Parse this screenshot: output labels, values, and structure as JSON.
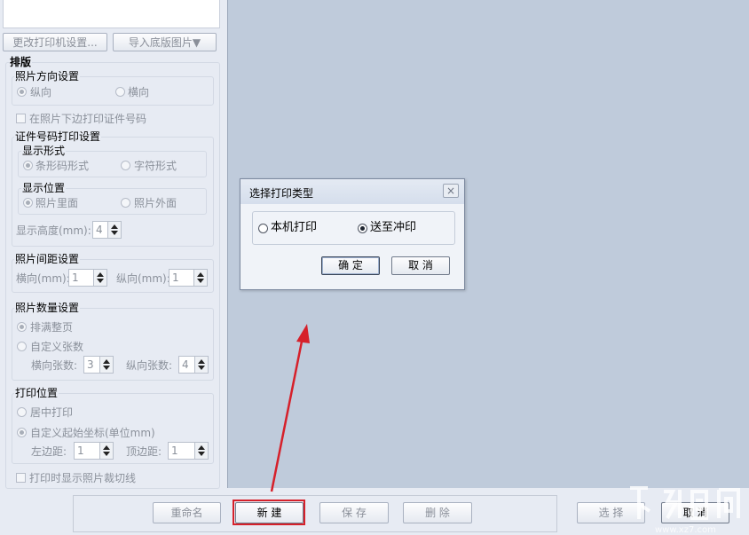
{
  "left_panel": {
    "change_printer_button": "更改打印机设置...",
    "import_background_button": "导入底版图片▼",
    "layout_section": {
      "title": "排版",
      "orientation": {
        "title": "照片方向设置",
        "portrait": "纵向",
        "landscape": "横向",
        "selected": "纵向"
      },
      "print_id_checkbox": "在照片下边打印证件号码",
      "id_print_settings": {
        "title": "证件号码打印设置",
        "display_form": {
          "title": "显示形式",
          "barcode": "条形码形式",
          "text": "字符形式",
          "selected": "条形码形式"
        },
        "display_position": {
          "title": "显示位置",
          "inside": "照片里面",
          "outside": "照片外面",
          "selected": "照片里面"
        },
        "height_label": "显示高度(mm):",
        "height_value": "4"
      }
    },
    "spacing": {
      "title": "照片间距设置",
      "horizontal_label": "横向(mm):",
      "horizontal_value": "1",
      "vertical_label": "纵向(mm):",
      "vertical_value": "1"
    },
    "quantity": {
      "title": "照片数量设置",
      "fill_page": "排满整页",
      "custom": "自定义张数",
      "selected": "排满整页",
      "horizontal_label": "横向张数:",
      "horizontal_value": "3",
      "vertical_label": "纵向张数:",
      "vertical_value": "4"
    },
    "position": {
      "title": "打印位置",
      "center": "居中打印",
      "custom": "自定义起始坐标(单位mm)",
      "selected": "自定义起始坐标(单位mm)",
      "left_label": "左边距:",
      "left_value": "1",
      "top_label": "顶边距:",
      "top_value": "1"
    },
    "cut_lines_checkbox": "打印时显示照片裁切线"
  },
  "dialog": {
    "title": "选择打印类型",
    "close": "×",
    "option_local": "本机打印",
    "option_send": "送至冲印",
    "selected": "送至冲印",
    "ok": "确  定",
    "cancel": "取  消"
  },
  "bottom_toolbar": {
    "rename": "重命名",
    "new": "新  建",
    "save": "保  存",
    "delete": "删  除",
    "select": "选  择",
    "cancel": "取  消"
  },
  "colors": {
    "highlight_red": "#d6202a",
    "canvas": "#bfcbdb",
    "panel": "#e7ebf3"
  }
}
